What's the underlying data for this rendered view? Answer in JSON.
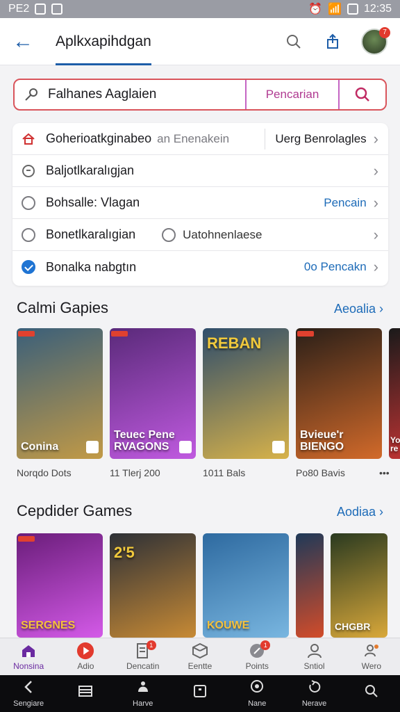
{
  "status_bar": {
    "left_text": "PE2",
    "time": "12:35"
  },
  "header": {
    "title": "Aplkxapihdgan"
  },
  "search": {
    "value": "Falhanes Aaglaien",
    "button_label": "Pencarian"
  },
  "filters": [
    {
      "label": "Goherioatkginabeo",
      "sub": "an Enenakein",
      "right": "Uerg Benrolagles",
      "icon": "home-icon"
    },
    {
      "label": "Baljotlkaralıgjan",
      "right": "",
      "icon": "timer-icon"
    },
    {
      "label": "Bohsalle: Vlagan",
      "right": "Pencain",
      "icon": "radio-icon"
    },
    {
      "label": "Bonetlkaralıgian",
      "right": "Uatohnenlaese",
      "icon": "radio-icon"
    },
    {
      "label": "Bonalka nabgtın",
      "right": "0o Pencakn",
      "icon": "check-icon"
    }
  ],
  "section1": {
    "title": "Calmi Gapies",
    "link": "Aeoalia"
  },
  "section2": {
    "title": "Cepdider Games",
    "link": "Aodiaa"
  },
  "cards1": [
    {
      "caption": "Norqdo Dots",
      "logo": "Conina",
      "colors": [
        "#3a5f7a",
        "#c29a46"
      ]
    },
    {
      "caption": "11 Tlerj 200",
      "logo": "Teuec Pene RVAGONS",
      "colors": [
        "#5a2a7a",
        "#c05ae0"
      ]
    },
    {
      "caption": "1011 Bals",
      "logo": "REBAN",
      "colors": [
        "#2f4d6b",
        "#d7b24a"
      ]
    },
    {
      "caption": "Po80 Bavis",
      "logo": "Bvieue'r BIENGO",
      "colors": [
        "#2a1f18",
        "#d26a2a"
      ]
    },
    {
      "caption": "",
      "logo": "Yo re",
      "colors": [
        "#1a1a1a",
        "#b33"
      ]
    }
  ],
  "cards2": [
    {
      "logo": "SERGNES",
      "colors": [
        "#6a1d7a",
        "#d45ae8"
      ]
    },
    {
      "logo": "2'5",
      "colors": [
        "#2d3036",
        "#c78a35"
      ]
    },
    {
      "logo": "KOUWE",
      "colors": [
        "#2e6aa0",
        "#79b6e0"
      ]
    },
    {
      "logo": "",
      "colors": [
        "#1f3958",
        "#d24c2a"
      ]
    },
    {
      "logo": "CHGBR",
      "colors": [
        "#2a3a20",
        "#d9a83a"
      ]
    }
  ],
  "tabs": [
    {
      "label": "Nonsina",
      "icon": "home-icon",
      "active": true
    },
    {
      "label": "Adio",
      "icon": "play-icon"
    },
    {
      "label": "Dencatin",
      "icon": "document-icon",
      "badge": "1"
    },
    {
      "label": "Eentte",
      "icon": "box-icon"
    },
    {
      "label": "Points",
      "icon": "points-icon",
      "badge": "1"
    },
    {
      "label": "Sntiol",
      "icon": "person-icon"
    },
    {
      "label": "Wero",
      "icon": "profile-icon"
    }
  ],
  "system_nav": [
    {
      "label": "Sengiare",
      "icon": "back-icon"
    },
    {
      "label": "",
      "icon": "menu-icon"
    },
    {
      "label": "Harve",
      "icon": "home-icon"
    },
    {
      "label": "",
      "icon": "square-icon"
    },
    {
      "label": "Nane",
      "icon": "location-icon"
    },
    {
      "label": "Nerave",
      "icon": "refresh-icon"
    },
    {
      "label": "",
      "icon": "search-icon"
    }
  ],
  "colors": {
    "accent": "#1d5da8",
    "search_border": "#d9545b",
    "purple": "#b03a91"
  }
}
